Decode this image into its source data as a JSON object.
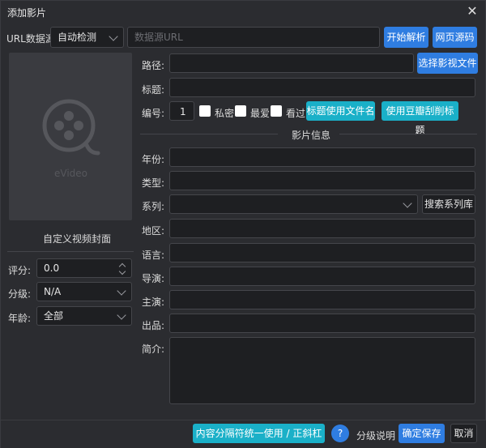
{
  "window": {
    "title": "添加影片"
  },
  "url_row": {
    "label": "URL数据源",
    "source_value": "自动检测",
    "url_placeholder": "数据源URL",
    "parse_button": "开始解析",
    "source_code_button": "网页源码"
  },
  "cover": {
    "watermark": "eVideo",
    "caption": "自定义视频封面"
  },
  "left_fields": {
    "rating": {
      "label": "评分:",
      "value": "0.0"
    },
    "grade": {
      "label": "分级:",
      "value": "N/A"
    },
    "age": {
      "label": "年龄:",
      "value": "全部"
    }
  },
  "form": {
    "path_label": "路径:",
    "choose_file_button": "选择影视文件",
    "title_label": "标题:",
    "number_label": "编号:",
    "number_value": "1",
    "private_label": "私密",
    "favorite_label": "最爱",
    "watched_label": "看过",
    "use_filename_button": "标题使用文件名",
    "douban_button": "使用豆瓣刮削标题",
    "section_title": "影片信息",
    "year_label": "年份:",
    "type_label": "类型:",
    "series_label": "系列:",
    "search_series_button": "搜索系列库",
    "region_label": "地区:",
    "language_label": "语言:",
    "director_label": "导演:",
    "actor_label": "主演:",
    "producer_label": "出品:",
    "summary_label": "简介:"
  },
  "footer": {
    "separator_button": "内容分隔符统一使用 / 正斜杠分开",
    "help_glyph": "?",
    "grade_help": "分级说明",
    "save_button": "确定保存",
    "cancel_button": "取消"
  },
  "icons": {
    "close": "close-icon",
    "film": "film-reel-icon"
  },
  "colors": {
    "background": "#2b2c30",
    "accent_blue": "#2f7de1",
    "accent_cyan": "#1ab0c8"
  }
}
